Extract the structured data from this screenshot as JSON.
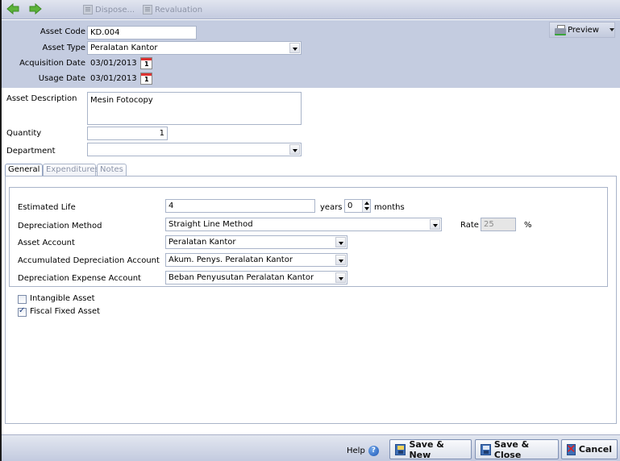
{
  "toolbar": {
    "back_icon": "arrow-left-icon",
    "forward_icon": "arrow-right-icon",
    "dispose_label": "Dispose...",
    "revaluation_label": "Revaluation",
    "preview_label": "Preview"
  },
  "header": {
    "asset_code": {
      "label": "Asset Code",
      "value": "KD.004"
    },
    "asset_type": {
      "label": "Asset Type",
      "value": "Peralatan Kantor"
    },
    "acquisition_date": {
      "label": "Acquisition Date",
      "value": "03/01/2013"
    },
    "usage_date": {
      "label": "Usage Date",
      "value": "03/01/2013"
    }
  },
  "details": {
    "asset_description": {
      "label": "Asset Description",
      "value": "Mesin Fotocopy"
    },
    "quantity": {
      "label": "Quantity",
      "value": "1"
    },
    "department": {
      "label": "Department",
      "value": ""
    }
  },
  "tabs": [
    {
      "label": "General",
      "active": true
    },
    {
      "label": "Expenditures",
      "active": false
    },
    {
      "label": "Notes",
      "active": false
    }
  ],
  "general": {
    "estimated_life": {
      "label": "Estimated Life",
      "years_value": "4",
      "years_label": "years",
      "months_value": "0",
      "months_label": "months"
    },
    "depreciation_method": {
      "label": "Depreciation Method",
      "value": "Straight Line Method"
    },
    "rate": {
      "label": "Rate",
      "value": "25",
      "unit": "%"
    },
    "asset_account": {
      "label": "Asset Account",
      "value": "Peralatan Kantor"
    },
    "accumulated_depreciation_account": {
      "label": "Accumulated Depreciation Account",
      "value": "Akum. Penys. Peralatan Kantor"
    },
    "depreciation_expense_account": {
      "label": "Depreciation Expense Account",
      "value": "Beban Penyusutan Peralatan Kantor"
    },
    "intangible_asset": {
      "label": "Intangible Asset",
      "checked": false
    },
    "fiscal_fixed_asset": {
      "label": "Fiscal Fixed Asset",
      "checked": true
    }
  },
  "footer": {
    "help_label": "Help",
    "save_new_label": "Save & New",
    "save_close_label": "Save & Close",
    "cancel_label": "Cancel"
  }
}
